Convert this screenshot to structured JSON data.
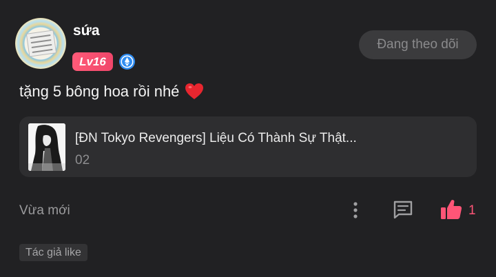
{
  "comment": {
    "username": "sứa",
    "level": "Lv16",
    "follow_label": "Đang theo dõi",
    "text": "tặng 5 bông hoa rồi nhé",
    "timestamp": "Vừa mới",
    "like_count": "1",
    "author_like_tag": "Tác giả like"
  },
  "story": {
    "title": "[ĐN Tokyo Revengers] Liệu Có Thành Sự Thật...",
    "chapter": "02"
  },
  "icons": {
    "heart": "heart-emoji",
    "verified": "ethereum-diamond-badge",
    "more": "vertical-dots-icon",
    "reply": "comment-bubble-icon",
    "like": "thumbs-up-icon"
  },
  "colors": {
    "background": "#212123",
    "accent_like": "#ff5577",
    "level_badge": "#f0466a",
    "verified_badge": "#2f8cf0",
    "card": "#2e2e30"
  }
}
